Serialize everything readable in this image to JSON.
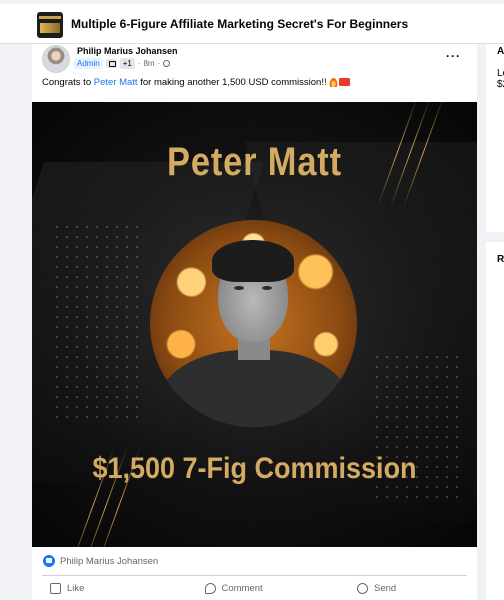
{
  "group": {
    "title": "Multiple 6-Figure Affiliate Marketing Secret's For Beginners"
  },
  "post": {
    "author": "Philip Marius Johansen",
    "role_badge": "Admin",
    "badge_count": "+1",
    "time": "8m",
    "separator": "·",
    "text_before": "Congrats to ",
    "mention": "Peter Matt",
    "text_after": " for making another 1,500 USD commission!! ",
    "more_icon": "more-options-icon"
  },
  "promo_image": {
    "name": "Peter Matt",
    "caption": "$1,500 7-Fig Commission",
    "accent_color": "#d3ab62"
  },
  "reactions": {
    "liked_by": "Philip Marius Johansen"
  },
  "actions": {
    "like": "Like",
    "comment": "Comment",
    "send": "Send"
  },
  "right_panel": {
    "line1": "A",
    "line2": "Le",
    "line3": "$2",
    "section": "R"
  },
  "colors": {
    "link": "#1877f2",
    "background": "#f0f2f5"
  }
}
